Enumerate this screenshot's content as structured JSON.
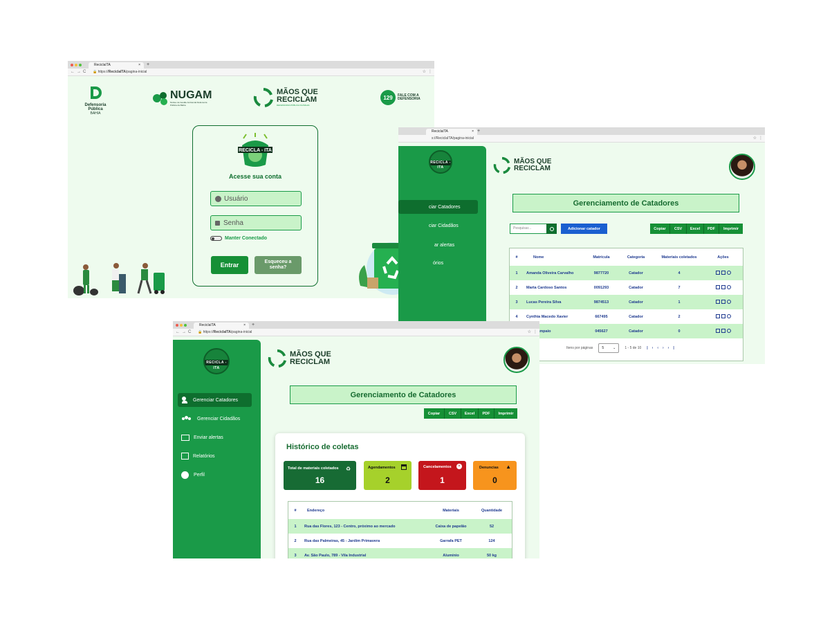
{
  "login": {
    "tab_title": "ReciclaITA",
    "url_prefix": "https://",
    "url_bold": "ReciclaITA",
    "url_rest": "/pagina-inicial",
    "defensoria": {
      "name": "Defensoria Pública",
      "sub": "BAHIA"
    },
    "nugam": {
      "name": "NUGAM",
      "sub": "Núcleo de Gestão Ambiental Defensoria Pública da Bahia"
    },
    "maos": {
      "line1": "MÃOS QUE",
      "line2": "RECICLAM",
      "sub": "DEFENSORIA PÚBLICA DA BAHIA"
    },
    "fale": {
      "number": "129",
      "line1": "FALE COM A",
      "line2": "DEFENSORIA"
    },
    "logo_text": "RECICLA - ITA",
    "heading": "Acesse sua conta",
    "username_placeholder": "Usuário",
    "password_placeholder": "Senha",
    "keep_connected": "Manter Conectado",
    "enter_button": "Entrar",
    "forgot_line1": "Esqueceu a",
    "forgot_line2": "senha?"
  },
  "catadores": {
    "tab_title": "ReciclaITA",
    "url_visible": "s://ReciclaITA/pagina-inicial",
    "menu": [
      "ciar Catadores",
      "ciar Cidadãos",
      "ar alertas",
      "órios"
    ],
    "title": "Gerenciamento de Catadores",
    "search_placeholder": "Pesquisar...",
    "add_button": "Adicionar catador",
    "export_buttons": [
      "Copiar",
      "CSV",
      "Excel",
      "PDF",
      "Imprimir"
    ],
    "columns": [
      "#",
      "Nome",
      "Matrícula",
      "Categoria",
      "Materiais coletados",
      "Ações"
    ],
    "rows": [
      {
        "id": "1",
        "name": "Amanda Oliveira Carvalho",
        "matricula": "9877720",
        "categoria": "Catador",
        "materiais": "4"
      },
      {
        "id": "2",
        "name": "Marta Cardoso Santos",
        "matricula": "0091293",
        "categoria": "Catador",
        "materiais": "7"
      },
      {
        "id": "3",
        "name": "Lucas Pereira Silva",
        "matricula": "9874513",
        "categoria": "Catador",
        "materiais": "1"
      },
      {
        "id": "4",
        "name": "Cynthia Macedo Xavier",
        "matricula": "667495",
        "categoria": "Catador",
        "materiais": "2"
      },
      {
        "id": "",
        "name": "aula Sampaio",
        "matricula": "045627",
        "categoria": "Catador",
        "materiais": "0"
      }
    ],
    "pager": {
      "label": "Itens por páginas",
      "size": "5",
      "range": "1 - 5 de 10"
    }
  },
  "historico": {
    "tab_title": "ReciclaITA",
    "url_prefix": "https://",
    "url_bold": "ReciclaITA",
    "url_rest": "/pagina-inicial",
    "menu": [
      {
        "label": "Gerenciar Catadores",
        "icon": "user-recycle-icon"
      },
      {
        "label": "Gerenciar Cidadãos",
        "icon": "users-icon"
      },
      {
        "label": "Enviar alertas",
        "icon": "mail-alert-icon"
      },
      {
        "label": "Relatórios",
        "icon": "reports-icon"
      },
      {
        "label": "Perfil",
        "icon": "profile-icon"
      }
    ],
    "title": "Gerenciamento de Catadores",
    "export_buttons": [
      "Copiar",
      "CSV",
      "Excel",
      "PDF",
      "Imprimir"
    ],
    "section_title": "Histórico de coletas",
    "cards": [
      {
        "label": "Total de materiais coletados",
        "value": "16",
        "color": "#176b34",
        "text": "#ffffff"
      },
      {
        "label": "Agendamentos",
        "value": "2",
        "color": "#a6d12b",
        "text": "#111111"
      },
      {
        "label": "Cancelamentos",
        "value": "1",
        "color": "#c4161c",
        "text": "#ffffff"
      },
      {
        "label": "Denuncias",
        "value": "0",
        "color": "#f7941d",
        "text": "#111111"
      }
    ],
    "columns": [
      "#",
      "Endereço",
      "Materiais",
      "Quantidade"
    ],
    "rows": [
      {
        "id": "1",
        "endereco": "Rua das Flores, 123 - Centro, próximo ao mercado",
        "material": "Caixa de papelão",
        "qtd": "52"
      },
      {
        "id": "2",
        "endereco": "Rua das Palmeiras, 45 - Jardim Primavera",
        "material": "Garrafa PET",
        "qtd": "124"
      },
      {
        "id": "3",
        "endereco": "Av. São Paulo, 789 - Vila Industrial",
        "material": "Alumínio",
        "qtd": "50 kg"
      }
    ]
  },
  "colors": {
    "primary": "#1a9a48",
    "dark_green": "#0e6e2e",
    "light_bg": "#eefbee",
    "title_bg": "#c9f3c9",
    "link_blue": "#1e3a8f",
    "add_blue": "#1a5fd0"
  }
}
